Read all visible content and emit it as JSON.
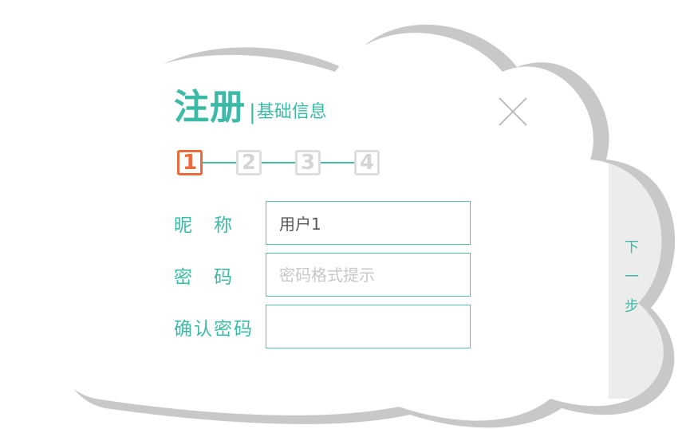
{
  "header": {
    "title": "注册",
    "separator": "|",
    "subtitle": "基础信息"
  },
  "close_icon": "close-icon",
  "steps": [
    {
      "label": "1",
      "active": true
    },
    {
      "label": "2",
      "active": false
    },
    {
      "label": "3",
      "active": false
    },
    {
      "label": "4",
      "active": false
    }
  ],
  "form": {
    "nickname_label": "昵　称",
    "nickname_value": "用户1",
    "password_label": "密　码",
    "password_placeholder": "密码格式提示",
    "confirm_label": "确认密码",
    "confirm_value": ""
  },
  "next_button": {
    "chars": [
      "下",
      "一",
      "步"
    ]
  },
  "colors": {
    "accent": "#3bbaa6",
    "active_step": "#ef6a3a",
    "inactive_step": "#dddddd",
    "cloud_shadow": "#c8c8c8",
    "next_panel": "#ececec"
  }
}
